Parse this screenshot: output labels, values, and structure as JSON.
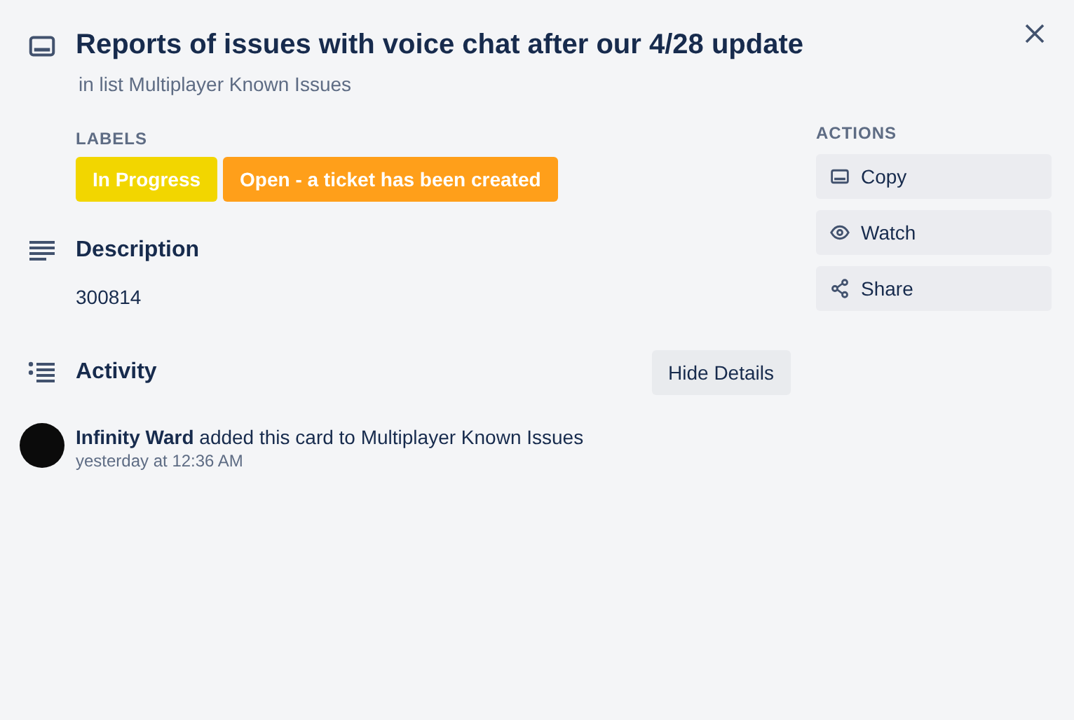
{
  "card": {
    "title": "Reports of issues with voice chat after our 4/28 update",
    "list_line": "in list Multiplayer Known Issues"
  },
  "labels": {
    "heading": "LABELS",
    "items": [
      {
        "text": "In Progress",
        "color": "#f2d600"
      },
      {
        "text": "Open - a ticket has been created",
        "color": "#ff9f1a"
      }
    ]
  },
  "description": {
    "heading": "Description",
    "text": "300814"
  },
  "activity": {
    "heading": "Activity",
    "toggle": "Hide Details",
    "entries": [
      {
        "text": "**Infinity Ward** added this card to Multiplayer Known Issues",
        "time": "yesterday at 12:36 AM"
      }
    ]
  },
  "actions": {
    "heading": "ACTIONS",
    "buttons": [
      {
        "kind": "copy",
        "label": "Copy"
      },
      {
        "kind": "watch",
        "label": "Watch"
      },
      {
        "kind": "share",
        "label": "Share"
      }
    ]
  }
}
